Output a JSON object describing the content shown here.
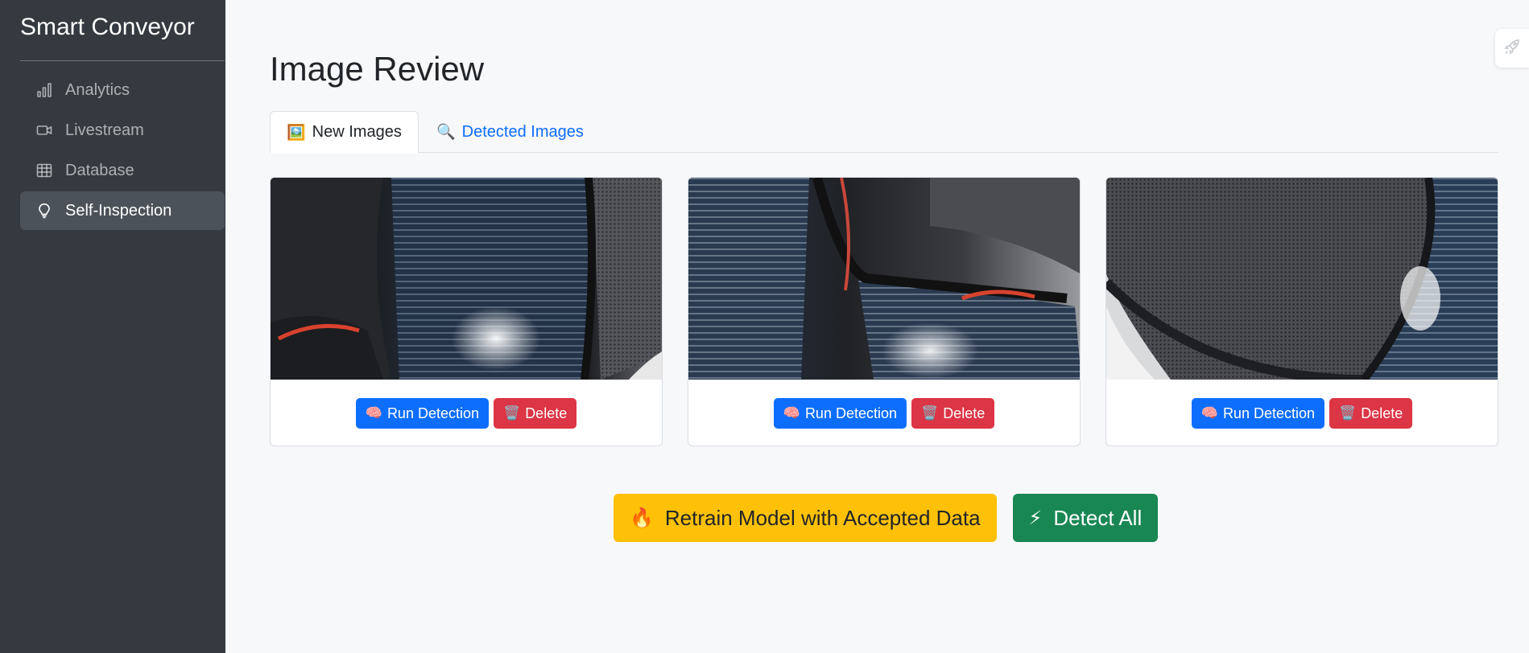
{
  "sidebar": {
    "brand": "Smart Conveyor",
    "items": [
      {
        "label": "Analytics",
        "icon": "bar-chart-icon",
        "active": false
      },
      {
        "label": "Livestream",
        "icon": "video-camera-icon",
        "active": false
      },
      {
        "label": "Database",
        "icon": "table-icon",
        "active": false
      },
      {
        "label": "Self-Inspection",
        "icon": "lightbulb-icon",
        "active": true
      }
    ]
  },
  "main": {
    "title": "Image Review",
    "tabs": [
      {
        "label": "New Images",
        "emoji": "🖼️",
        "active": true
      },
      {
        "label": "Detected Images",
        "emoji": "🔍",
        "active": false
      }
    ],
    "cards": [
      {
        "run_label": "Run Detection",
        "run_emoji": "🧠",
        "delete_label": "Delete",
        "delete_emoji": "🗑️"
      },
      {
        "run_label": "Run Detection",
        "run_emoji": "🧠",
        "delete_label": "Delete",
        "delete_emoji": "🗑️"
      },
      {
        "run_label": "Run Detection",
        "run_emoji": "🧠",
        "delete_label": "Delete",
        "delete_emoji": "🗑️"
      }
    ],
    "actions": {
      "retrain_label": "Retrain Model with Accepted Data",
      "retrain_emoji": "🔥",
      "detect_all_label": "Detect All",
      "detect_all_emoji": "⚡"
    }
  },
  "colors": {
    "sidebar_bg": "#343a40",
    "primary": "#0d6efd",
    "danger": "#dc3545",
    "warning": "#ffc107",
    "success": "#198754"
  }
}
